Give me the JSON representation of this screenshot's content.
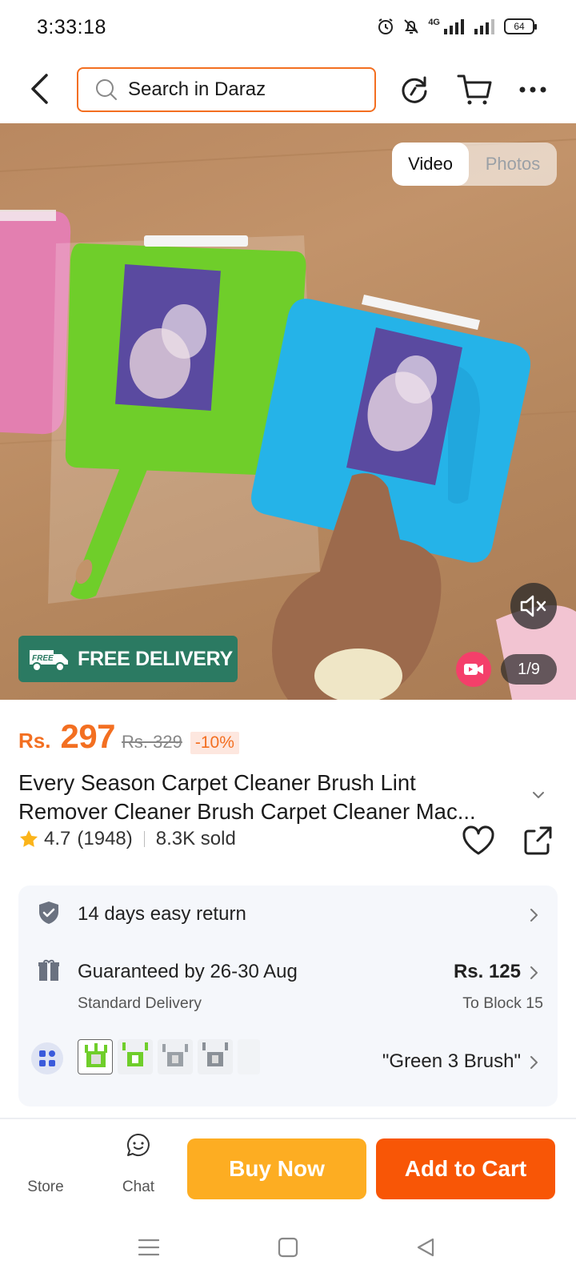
{
  "status_bar": {
    "time": "3:33:18",
    "network": "4G",
    "battery": "64"
  },
  "header": {
    "search_placeholder": "Search in Daraz"
  },
  "media": {
    "toggle_video": "Video",
    "toggle_photos": "Photos",
    "free_delivery_badge": "FREE DELIVERY",
    "free_badge_small": "FREE",
    "counter": "1/9"
  },
  "product": {
    "currency": "Rs.",
    "price": "297",
    "original_price": "Rs. 329",
    "discount": "-10%",
    "title_line1": "Every Season Carpet Cleaner Brush Lint",
    "title_line2": "Remover Cleaner Brush Carpet Cleaner Mac...",
    "rating": "4.7",
    "reviews": "(1948)",
    "sold": "8.3K sold"
  },
  "info": {
    "returns": "14 days easy return",
    "delivery_guarantee": "Guaranteed by 26-30 Aug",
    "delivery_type": "Standard Delivery",
    "delivery_price": "Rs. 125",
    "delivery_to": "To Block 15",
    "selected_variant": "\"Green 3 Brush\""
  },
  "actions": {
    "store_label": "Store",
    "chat_label": "Chat",
    "buy_now": "Buy Now",
    "add_to_cart": "Add to Cart"
  },
  "colors": {
    "accent": "#f36f21",
    "buy_now": "#fdad22",
    "add_to_cart": "#f85606",
    "free_delivery": "#2b7a62"
  }
}
